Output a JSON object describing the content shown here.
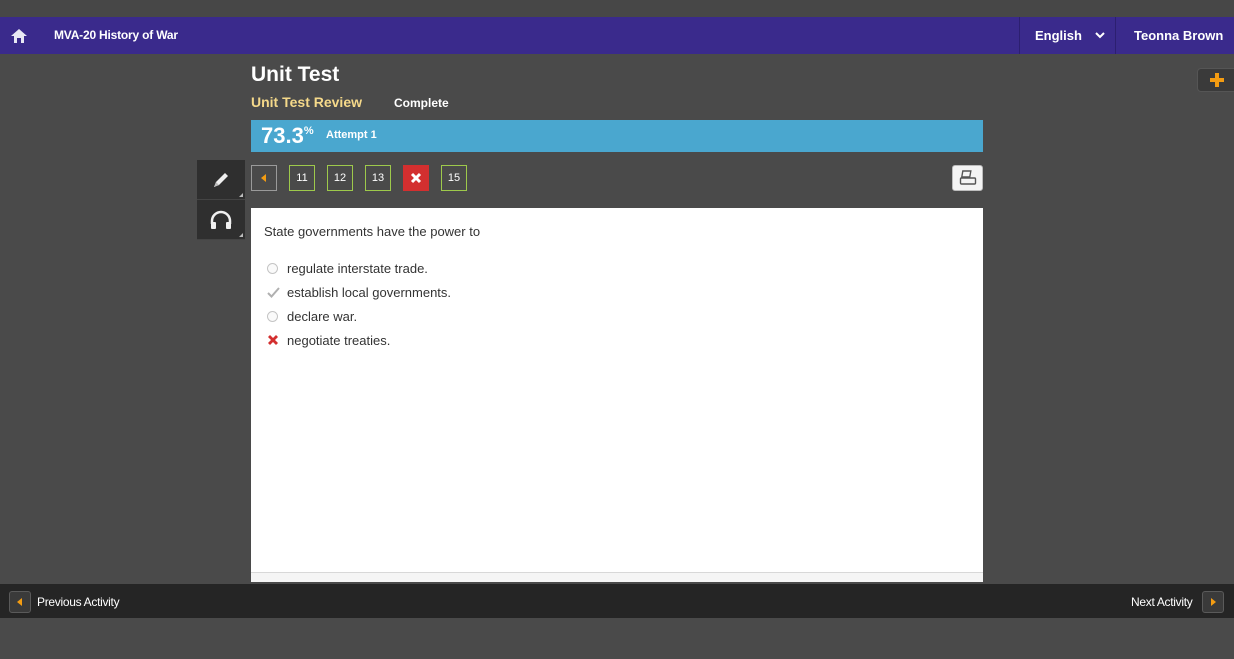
{
  "header": {
    "course_title": "MVA-20 History of War",
    "language": "English",
    "user_name": "Teonna Brown"
  },
  "test": {
    "title": "Unit Test",
    "subtitle": "Unit Test Review",
    "status": "Complete",
    "score": "73.3",
    "score_unit": "%",
    "attempt": "Attempt 1"
  },
  "question_nav": {
    "items": [
      {
        "label": "11",
        "state": "correct"
      },
      {
        "label": "12",
        "state": "correct"
      },
      {
        "label": "13",
        "state": "correct"
      },
      {
        "label": "",
        "state": "incorrect",
        "icon": "x-icon"
      },
      {
        "label": "15",
        "state": "correct"
      }
    ]
  },
  "question": {
    "prompt": "State governments have the power to",
    "answers": [
      {
        "text": "regulate interstate trade.",
        "mark": "radio"
      },
      {
        "text": "establish local governments.",
        "mark": "check"
      },
      {
        "text": "declare war.",
        "mark": "radio"
      },
      {
        "text": "negotiate treaties.",
        "mark": "x"
      }
    ]
  },
  "footer": {
    "previous_label": "Previous Activity",
    "next_label": "Next Activity"
  },
  "colors": {
    "header_bg": "#3a2a8c",
    "score_bar": "#4aa7cf",
    "correct_border": "#9ec94b",
    "incorrect": "#d32f2f",
    "accent_orange": "#f39c12"
  }
}
